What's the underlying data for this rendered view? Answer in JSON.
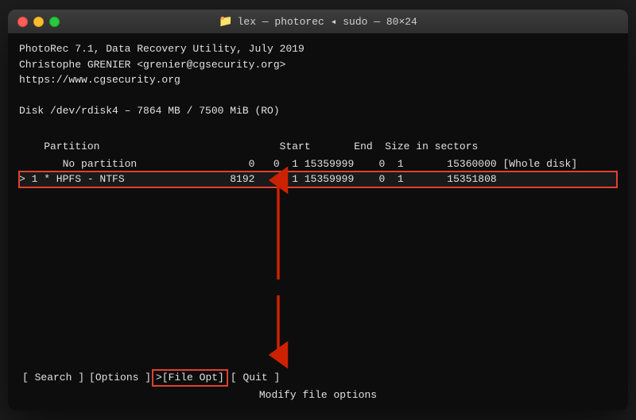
{
  "window": {
    "title": "lex — photorec ◂ sudo — 80×24",
    "folder_icon": "📁"
  },
  "terminal": {
    "line1": "PhotoRec 7.1, Data Recovery Utility, July 2019",
    "line2": "Christophe GRENIER <grenier@cgsecurity.org>",
    "line3": "https://www.cgsecurity.org",
    "line4": "",
    "line5": "Disk /dev/rdisk4 – 7864 MB / 7500 MiB (RO)",
    "line6": "",
    "partition_header": "    Partition                             Start       End  Size in sectors",
    "partition_nopart": "       No partition                  0   0  1 15359999    0  1       15360000 [Whole disk]",
    "partition_selected": "> 1 * HPFS - NTFS                 8192   0  1 15359999    0  1       15351808"
  },
  "bottom_menu": {
    "search": "[ Search ]",
    "options": "[Options ]",
    "file_opt": ">[File Opt]",
    "quit": "[ Quit  ]",
    "modify_text": "Modify file options"
  },
  "arrows": {
    "up_color": "#cc2200",
    "down_color": "#cc2200"
  }
}
